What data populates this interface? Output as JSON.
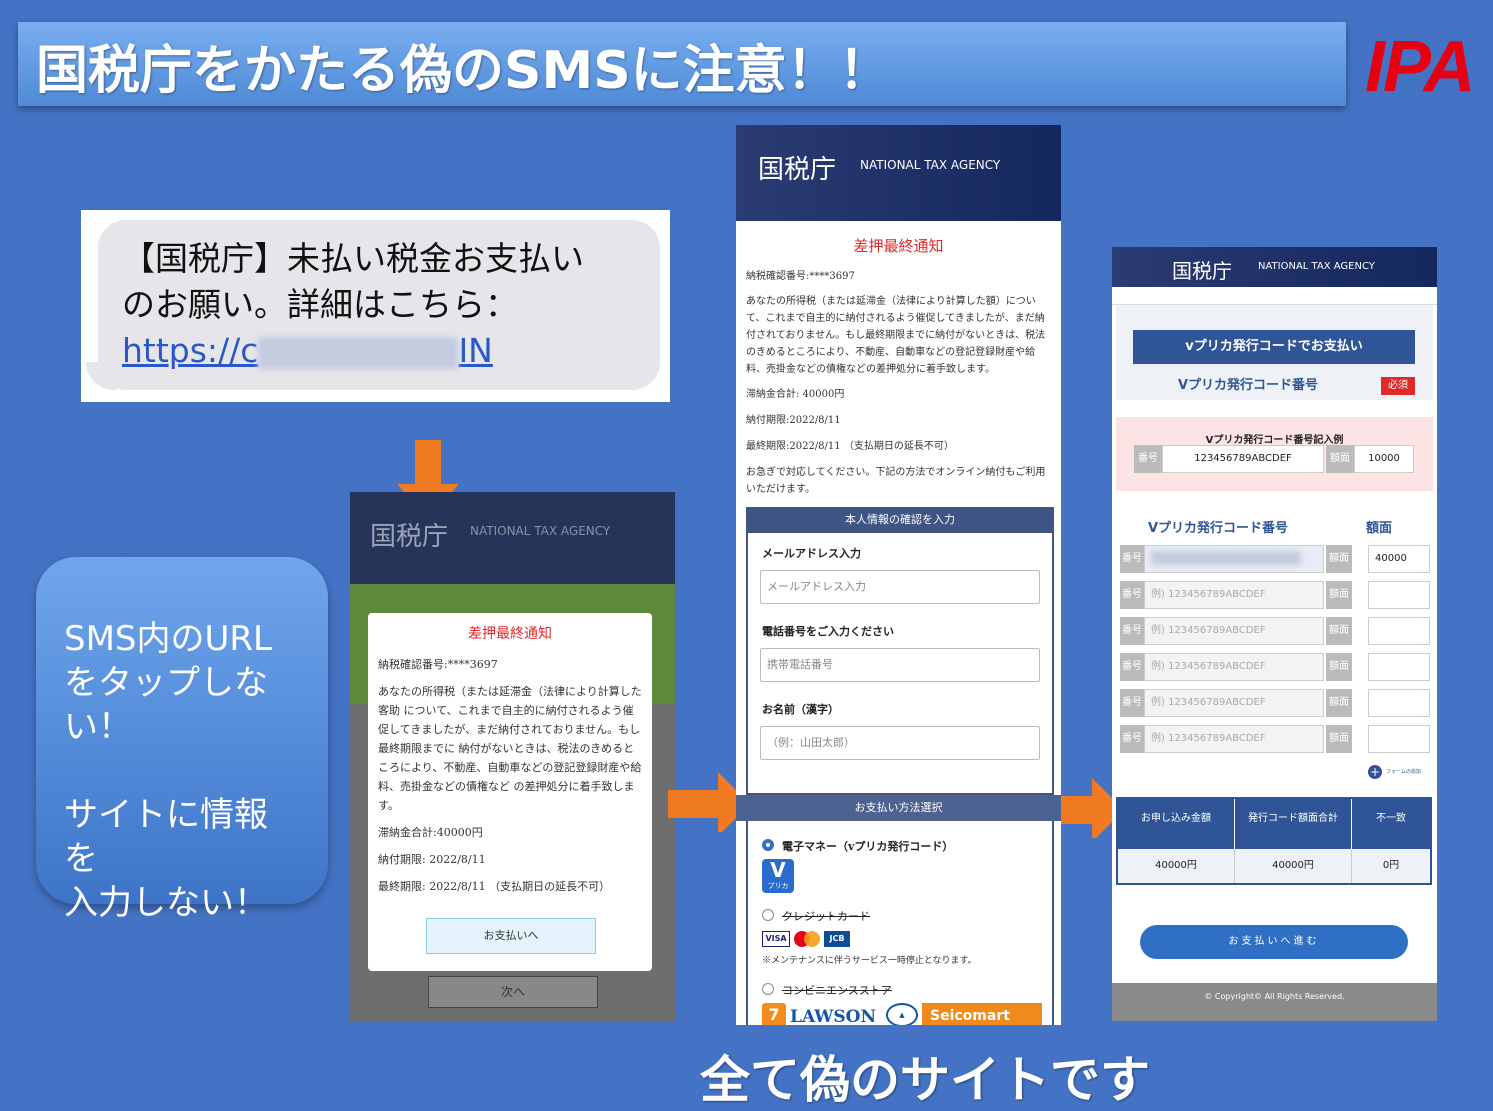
{
  "title": "国税庁をかたる偽のSMSに注意！！",
  "logo": "IPA",
  "sms": {
    "line1": "【国税庁】未払い税金お支払い",
    "line2": "のお願い。詳細はこちら：",
    "link_start": "https://c",
    "link_end": "IN"
  },
  "warning": {
    "line1": "SMS内のURL",
    "line2": "をタップしない！",
    "line3": "サイトに情報を",
    "line4": "入力しない！"
  },
  "phone1": {
    "header_title": "国税庁",
    "header_sub": "NATIONAL TAX AGENCY",
    "modal_title": "差押最終通知",
    "confirm_no": "納税確認番号:****3697",
    "body": "あなたの所得税（または延滞金（法律により計算した客助 について、これまで自主的に納付されるよう催促してきましたが、まだ納付されておりません。もし最終期限までに 納付がないときは、税法のきめるところにより、不動産、自動車などの登記登録財産や給料、売掛金などの債権など の差押処分に着手致します。",
    "total": "滞納金合計:40000円",
    "due": "納付期限: 2022/8/11",
    "final": "最終期限: 2022/8/11 （支払期日の延長不可）",
    "button": "お支払いへ",
    "next": "次へ"
  },
  "phone2": {
    "header_title": "国税庁",
    "header_sub": "NATIONAL TAX AGENCY",
    "heading": "差押最終通知",
    "confirm_no": "納税確認番号:****3697",
    "body": "あなたの所得税（または延滞金（法律により計算した額）について、これまで自主的に納付されるよう催促してきましたが、まだ納付されておりません。もし最終期限までに納付がないときは、税法のきめるところにより、不動産、自動車などの登記登録財産や給料、売掛金などの債権などの差押処分に着手致します。",
    "total": "滞納金合計: 40000円",
    "due": "納付期限:2022/8/11",
    "final": "最終期限:2022/8/11 （支払期日の延長不可）",
    "notice": "お急ぎで対応してください。下記の方法でオンライン納付もご利用いただけます。",
    "section1": "本人情報の確認を入力",
    "email_label": "メールアドレス入力",
    "email_placeholder": "メールアドレス入力",
    "phone_label": "電話番号をご入力ください",
    "phone_placeholder": "携帯電話番号",
    "name_label": "お名前（漢字）",
    "name_placeholder": "（例：山田太郎）",
    "section2": "お支払い方法選択",
    "option1": "電子マネー（vプリカ発行コード）",
    "vpreca_letter": "V",
    "vpreca_sub": "プリカ",
    "option2": "クレジットカード",
    "card_brands": [
      "VISA",
      "JCB"
    ],
    "maintenance": "※メンテナンスに伴うサービス一時停止となります。",
    "option3": "コンビニエンスストア",
    "stores": [
      "LAWSON",
      "Seicomart"
    ]
  },
  "phone3": {
    "header_title": "国税庁",
    "header_sub": "NATIONAL TAX AGENCY",
    "pay_button": "vプリカ発行コードでお支払い",
    "code_label": "Vプリカ発行コード番号",
    "required": "必須",
    "example_title": "Vプリカ発行コード番号記入例",
    "tag_number": "番号",
    "example_code": "123456789ABCDEF",
    "tag_amount": "額面",
    "example_amount": "10000",
    "col_code": "Vプリカ発行コード番号",
    "col_amount": "額面",
    "first_amount": "40000",
    "row_placeholder": "例) 123456789ABCDEF",
    "add_form": "フォームの追加",
    "table_head": [
      "お申し込み金額",
      "発行コード額面合計",
      "不一致"
    ],
    "table_values": [
      "40000円",
      "40000円",
      "0円"
    ],
    "proceed": "お支払いへ進む",
    "footer": "© Copyright© All Rights Reserved."
  },
  "bottom_text": "全て偽のサイトです",
  "colors": {
    "background": "#4472c4",
    "accent_red": "#e60012",
    "arrow": "#f07a22",
    "navy": "#2f5597"
  }
}
